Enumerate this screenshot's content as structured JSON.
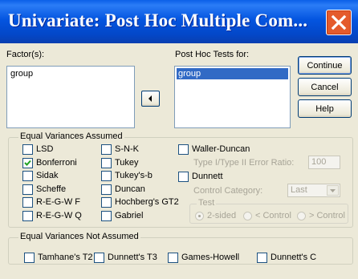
{
  "window": {
    "title": "Univariate: Post Hoc Multiple Com..."
  },
  "factors": {
    "label": "Factor(s):",
    "items": [
      "group"
    ]
  },
  "posthoc_for": {
    "label": "Post Hoc Tests for:",
    "items": [
      "group"
    ]
  },
  "buttons": {
    "continue": "Continue",
    "cancel": "Cancel",
    "help": "Help"
  },
  "equal_var": {
    "title": "Equal Variances Assumed",
    "col1": [
      {
        "label": "LSD",
        "checked": false
      },
      {
        "label": "Bonferroni",
        "checked": true
      },
      {
        "label": "Sidak",
        "checked": false
      },
      {
        "label": "Scheffe",
        "checked": false
      },
      {
        "label": "R-E-G-W F",
        "checked": false
      },
      {
        "label": "R-E-G-W Q",
        "checked": false
      }
    ],
    "col2": [
      {
        "label": "S-N-K",
        "checked": false
      },
      {
        "label": "Tukey",
        "checked": false
      },
      {
        "label": "Tukey's-b",
        "checked": false
      },
      {
        "label": "Duncan",
        "checked": false
      },
      {
        "label": "Hochberg's GT2",
        "checked": false
      },
      {
        "label": "Gabriel",
        "checked": false
      }
    ],
    "waller": {
      "label": "Waller-Duncan",
      "checked": false
    },
    "ratio_label": "Type I/Type II Error Ratio:",
    "ratio_value": "100",
    "dunnett": {
      "label": "Dunnett",
      "checked": false
    },
    "control_label": "Control Category:",
    "control_value": "Last",
    "test_title": "Test",
    "test_options": [
      "2-sided",
      "< Control",
      "> Control"
    ],
    "test_selected": "2-sided"
  },
  "unequal_var": {
    "title": "Equal Variances Not Assumed",
    "items": [
      {
        "label": "Tamhane's T2",
        "checked": false
      },
      {
        "label": "Dunnett's T3",
        "checked": false
      },
      {
        "label": "Games-Howell",
        "checked": false
      },
      {
        "label": "Dunnett's C",
        "checked": false
      }
    ]
  },
  "icons": {
    "close": "close-icon",
    "move": "arrow-left-icon",
    "check": "checkmark-icon",
    "dropdown": "chevron-down-icon"
  }
}
